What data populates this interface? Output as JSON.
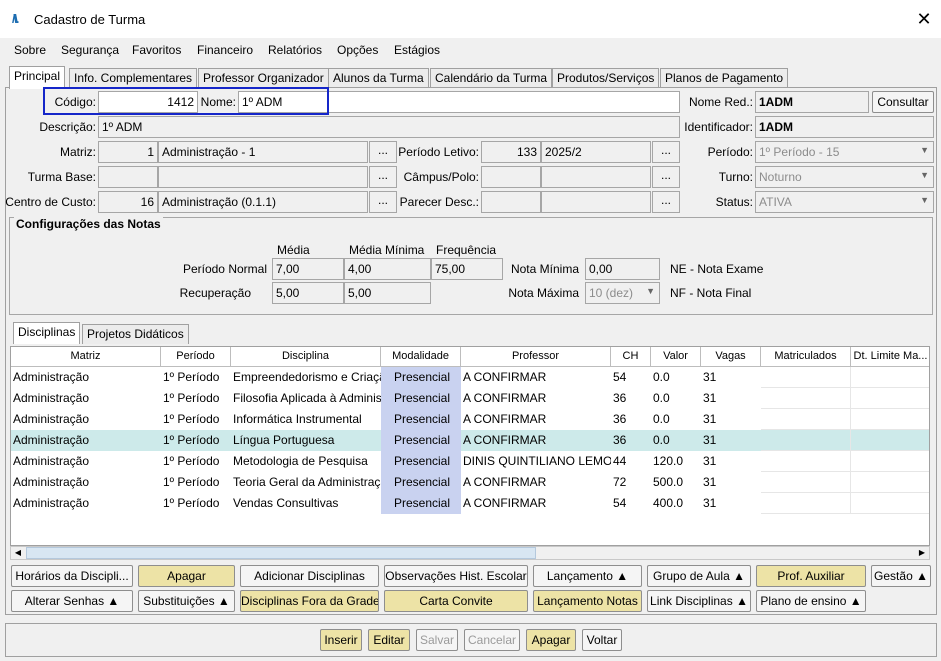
{
  "window": {
    "title": "Cadastro de Turma",
    "logo": "/\\\\.",
    "close": "✕"
  },
  "menu": [
    "Sobre",
    "Segurança",
    "Favoritos",
    "Financeiro",
    "Relatórios",
    "Opções",
    "Estágios"
  ],
  "tabs": [
    "Principal",
    "Info. Complementares",
    "Professor Organizador",
    "Alunos da Turma",
    "Calendário da Turma",
    "Produtos/Serviços",
    "Planos de Pagamento"
  ],
  "form": {
    "codigo_label": "Código:",
    "codigo": "1412",
    "nome_label": "Nome:",
    "nome": "1º ADM",
    "nome_red_label": "Nome Red.:",
    "nome_red": "1ADM",
    "consultar": "Consultar",
    "descricao_label": "Descrição:",
    "descricao": "1º ADM",
    "identificador_label": "Identificador:",
    "identificador": "1ADM",
    "matriz_label": "Matriz:",
    "matriz_code": "1",
    "matriz_name": "Administração - 1",
    "periodo_letivo_label": "Período Letivo:",
    "periodo_letivo_code": "133",
    "periodo_letivo": "2025/2",
    "periodo_label": "Período:",
    "periodo": "1º Período - 15",
    "turma_base_label": "Turma Base:",
    "campus_label": "Câmpus/Polo:",
    "turno_label": "Turno:",
    "turno": "Noturno",
    "centro_label": "Centro de Custo:",
    "centro_code": "16",
    "centro_name": "Administração (0.1.1)",
    "parecer_label": "Parecer Desc.:",
    "status_label": "Status:",
    "status": "ATIVA",
    "dots": "..."
  },
  "notas": {
    "title": "Configurações das Notas",
    "media": "Média",
    "media_min": "Média Mínima",
    "frequencia": "Frequência",
    "periodo_normal": "Período Normal",
    "pn_media": "7,00",
    "pn_media_min": "4,00",
    "pn_freq": "75,00",
    "recuperacao": "Recuperação",
    "rec_media": "5,00",
    "rec_media_min": "5,00",
    "nota_minima_label": "Nota Mínima",
    "nota_minima": "0,00",
    "nota_maxima_label": "Nota Máxima",
    "nota_maxima": "10 (dez)",
    "ne": "NE - Nota Exame",
    "nf": "NF - Nota Final"
  },
  "subtabs": [
    "Disciplinas",
    "Projetos Didáticos"
  ],
  "table": {
    "headers": [
      "Matriz",
      "Período",
      "Disciplina",
      "Modalidade",
      "Professor",
      "CH",
      "Valor",
      "Vagas",
      "Matriculados",
      "Dt. Limite Ma..."
    ],
    "rows": [
      [
        "Administração",
        "1º Período",
        "Empreendedorismo e Criação",
        "Presencial",
        "A CONFIRMAR",
        "54",
        "0.0",
        "31"
      ],
      [
        "Administração",
        "1º Período",
        "Filosofia Aplicada à Administração",
        "Presencial",
        "A CONFIRMAR",
        "36",
        "0.0",
        "31"
      ],
      [
        "Administração",
        "1º Período",
        "Informática Instrumental",
        "Presencial",
        "A CONFIRMAR",
        "36",
        "0.0",
        "31"
      ],
      [
        "Administração",
        "1º Período",
        "Língua Portuguesa",
        "Presencial",
        "A CONFIRMAR",
        "36",
        "0.0",
        "31"
      ],
      [
        "Administração",
        "1º Período",
        "Metodologia de Pesquisa",
        "Presencial",
        "DINIS QUINTILIANO LEMOS",
        "44",
        "120.0",
        "31"
      ],
      [
        "Administração",
        "1º Período",
        "Teoria Geral da Administração",
        "Presencial",
        "A CONFIRMAR",
        "72",
        "500.0",
        "31"
      ],
      [
        "Administração",
        "1º Período",
        "Vendas Consultivas",
        "Presencial",
        "A CONFIRMAR",
        "54",
        "400.0",
        "31"
      ]
    ]
  },
  "buttons_row1": [
    "Horários da Discipli...",
    "Apagar",
    "Adicionar Disciplinas",
    "Observações Hist. Escolar",
    "Lançamento ▲",
    "Grupo de Aula ▲",
    "Prof. Auxiliar",
    "Gestão ▲"
  ],
  "buttons_row2": [
    "Alterar Senhas ▲",
    "Substituições ▲",
    "Disciplinas Fora da Grade",
    "Carta Convite",
    "Lançamento Notas",
    "Link Disciplinas ▲",
    "Plano de ensino ▲"
  ],
  "bottom": [
    "Inserir",
    "Editar",
    "Salvar",
    "Cancelar",
    "Apagar",
    "Voltar"
  ]
}
